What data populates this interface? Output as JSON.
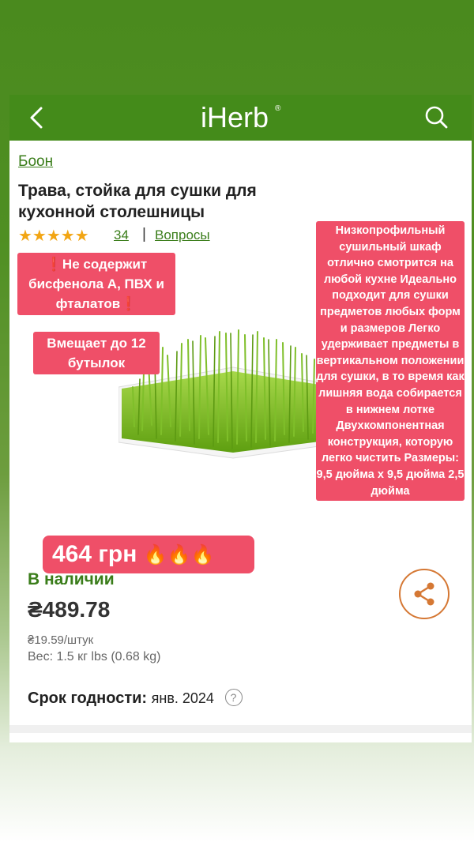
{
  "header": {
    "logo_text": "iHerb",
    "logo_reg": "®",
    "back_icon": "chevron-left-icon",
    "search_icon": "search-icon",
    "bar_color": "#448b1a"
  },
  "product": {
    "brand": "Боон",
    "title": "Трава, стойка для сушки для кухонной столешницы",
    "stars": "★★★★★",
    "rating": 5,
    "reviews_count": "34",
    "separator": "|",
    "questions_link": "Вопросы",
    "in_stock": "В наличии",
    "price": "₴489.78",
    "unit_price": "₴19.59/штук",
    "weight": "Вес: 1.5 кг lbs (0.68 kg)",
    "expiry_label": "Срок годности:",
    "expiry_value": "янв. 2024",
    "help_icon": "?"
  },
  "overlays": {
    "tag_bpa": "❗Не содержит бисфенола А, ПВХ и фталатов❗",
    "tag_capacity": "Вмещает до 12 бутылок",
    "tag_description": "Низкопрофильный сушильный шкаф отлично смотрится на любой кухне Идеально подходит для сушки предметов любых форм и размеров Легко удерживает предметы в вертикальном положении для сушки, в то время как лишняя вода собирается в нижнем лотке Двухкомпонентная конструкция, которую легко чистить Размеры: 9,5 дюйма x 9,5 дюйма 2,5 дюйма",
    "sale_price": "464 грн",
    "sale_emoji": "🔥🔥🔥",
    "tag_color": "#ef4f68"
  },
  "colors": {
    "accent_green": "#3a7d1a",
    "share_orange": "#d57834",
    "star_color": "#f2a513"
  }
}
